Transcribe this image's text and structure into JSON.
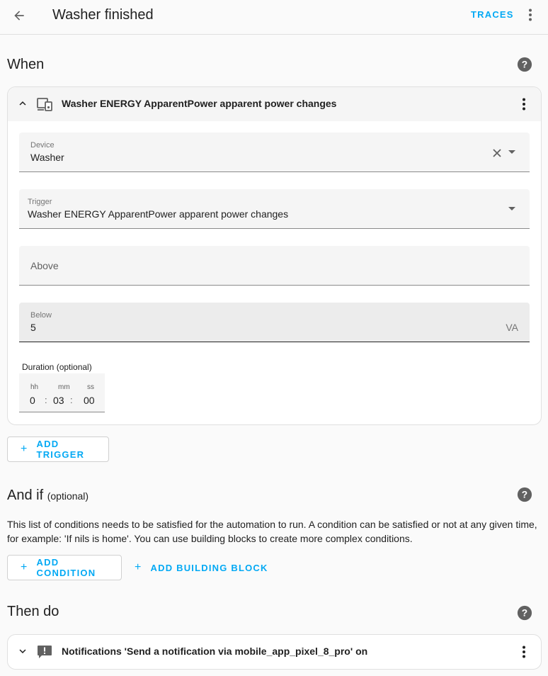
{
  "header": {
    "title": "Washer finished",
    "traces_label": "TRACES",
    "back_icon": "arrow-left-icon",
    "menu_icon": "dots-vertical-icon"
  },
  "when": {
    "title": "When",
    "help_icon": "help-circle-icon",
    "trigger": {
      "title": "Washer ENERGY ApparentPower apparent power changes",
      "icon": "device-hub-icon",
      "device": {
        "label": "Device",
        "value": "Washer"
      },
      "trigger_field": {
        "label": "Trigger",
        "value": "Washer ENERGY ApparentPower apparent power changes"
      },
      "above": {
        "placeholder": "Above"
      },
      "below": {
        "label": "Below",
        "value": "5",
        "unit": "VA"
      },
      "duration": {
        "label": "Duration (optional)",
        "hh_label": "hh",
        "hh": "0",
        "mm_label": "mm",
        "mm": "03",
        "ss_label": "ss",
        "ss": "00",
        "separator": ":"
      }
    },
    "add_trigger_label": "ADD TRIGGER"
  },
  "and_if": {
    "title": "And if",
    "optional": "(optional)",
    "description": "This list of conditions needs to be satisfied for the automation to run. A condition can be satisfied or not at any given time, for example: 'If nils is home'. You can use building blocks to create more complex conditions.",
    "add_condition_label": "ADD CONDITION",
    "add_building_block_label": "ADD BUILDING BLOCK"
  },
  "then_do": {
    "title": "Then do",
    "action": {
      "title": "Notifications 'Send a notification via mobile_app_pixel_8_pro' on",
      "icon": "message-alert-icon"
    }
  },
  "colors": {
    "accent": "#03a9f4",
    "text": "#212121",
    "icon": "#616161"
  }
}
